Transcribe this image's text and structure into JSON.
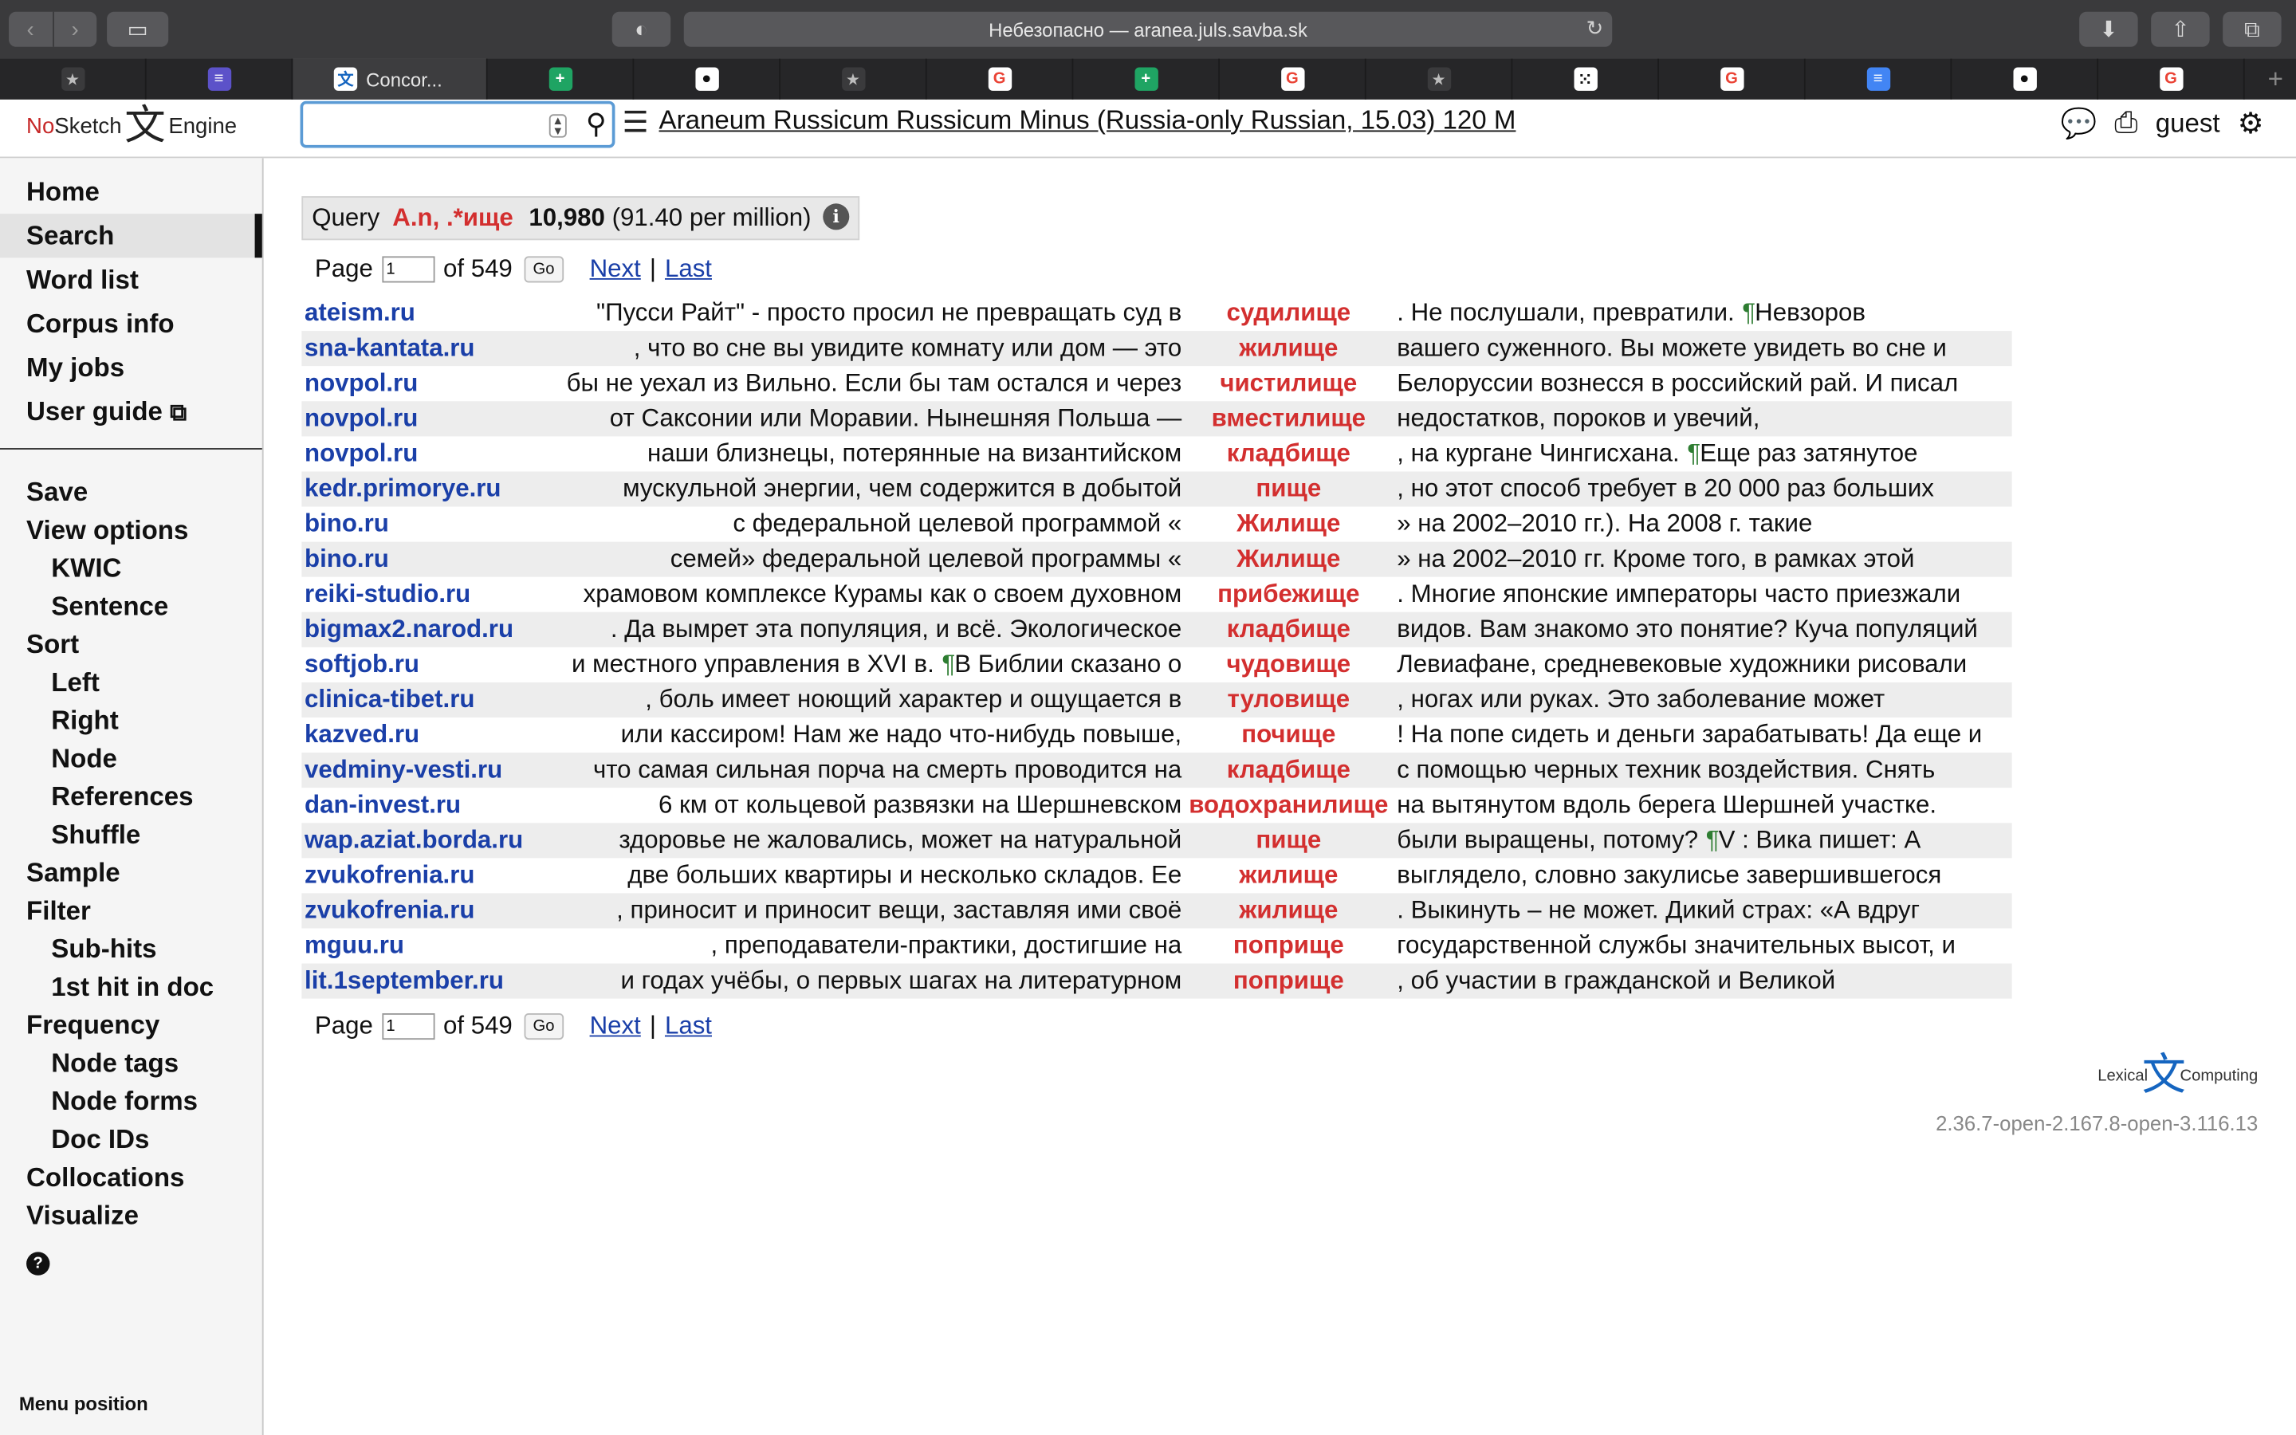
{
  "browser": {
    "url_text": "Небезопасно — aranea.juls.savba.sk",
    "active_tab_title": "Concor..."
  },
  "tabs": [
    {
      "icon": "star-icon",
      "glyph": "★",
      "bg": "#3a3a3c",
      "fg": "#bdbdbd"
    },
    {
      "icon": "list-icon",
      "glyph": "≡",
      "bg": "#5c52c9",
      "fg": "#ffffff"
    },
    {
      "icon": "sketch-engine-icon",
      "glyph": "文",
      "bg": "#ffffff",
      "fg": "#1565c0",
      "active": true
    },
    {
      "icon": "sheets-icon",
      "glyph": "+",
      "bg": "#1fa463",
      "fg": "#ffffff"
    },
    {
      "icon": "github-icon",
      "glyph": "●",
      "bg": "#ffffff",
      "fg": "#111111"
    },
    {
      "icon": "star-icon",
      "glyph": "★",
      "bg": "#3a3a3c",
      "fg": "#bdbdbd"
    },
    {
      "icon": "google-icon",
      "glyph": "G",
      "bg": "#ffffff",
      "fg": "#ea4335"
    },
    {
      "icon": "sheets-icon",
      "glyph": "+",
      "bg": "#1fa463",
      "fg": "#ffffff"
    },
    {
      "icon": "google-icon",
      "glyph": "G",
      "bg": "#ffffff",
      "fg": "#ea4335"
    },
    {
      "icon": "star-icon",
      "glyph": "★",
      "bg": "#3a3a3c",
      "fg": "#bdbdbd"
    },
    {
      "icon": "dice-icon",
      "glyph": "⁙",
      "bg": "#ffffff",
      "fg": "#111111"
    },
    {
      "icon": "google-icon",
      "glyph": "G",
      "bg": "#ffffff",
      "fg": "#ea4335"
    },
    {
      "icon": "docs-icon",
      "glyph": "≡",
      "bg": "#4285f4",
      "fg": "#ffffff"
    },
    {
      "icon": "github-icon",
      "glyph": "●",
      "bg": "#ffffff",
      "fg": "#111111"
    },
    {
      "icon": "google-icon",
      "glyph": "G",
      "bg": "#ffffff",
      "fg": "#ea4335"
    }
  ],
  "header": {
    "logo_no": "No",
    "logo_sketch": "Sketch",
    "logo_engine": "Engine",
    "search_value": "",
    "corpus_name": "Araneum Russicum Russicum Minus (Russia-only Russian, 15.03) 120 M",
    "user": "guest"
  },
  "sidebar": {
    "group1": [
      "Home",
      "Search",
      "Word list",
      "Corpus info",
      "My jobs",
      "User guide"
    ],
    "selected": "Search",
    "menu_position": "Menu position"
  },
  "query": {
    "label": "Query",
    "expr": "A.n, .*ище",
    "count": "10,980",
    "per_million": "(91.40 per million)"
  },
  "pager": {
    "page_label": "Page",
    "page_value": "1",
    "of_text": "of 549",
    "go": "Go",
    "next": "Next",
    "sep": "|",
    "last": "Last"
  },
  "concordance": [
    {
      "ref": "ateism.ru",
      "left": "\"Пусси Райт\" - просто просил не превращать суд в",
      "kw": "судилище",
      "right_pre": ". Не послушали, превратили. ",
      "para": "¶",
      "right_post": "Невзоров"
    },
    {
      "ref": "sna-kantata.ru",
      "left": ", что во сне вы увидите комнату или дом — это",
      "kw": "жилище",
      "right_pre": "вашего суженного. Вы можете увидеть во сне и",
      "para": "",
      "right_post": ""
    },
    {
      "ref": "novpol.ru",
      "left": "бы не уехал из Вильно. Если бы там остался и через",
      "kw": "чистилище",
      "right_pre": "Белоруссии вознесся в российский рай. И писал",
      "para": "",
      "right_post": ""
    },
    {
      "ref": "novpol.ru",
      "left": "от Саксонии или Моравии. Нынешняя Польша —",
      "kw": "вместилище",
      "right_pre": "недостатков, пороков и увечий,",
      "para": "",
      "right_post": ""
    },
    {
      "ref": "novpol.ru",
      "left": "наши близнецы, потерянные на византийском",
      "kw": "кладбище",
      "right_pre": ", на кургане Чингисхана. ",
      "para": "¶",
      "right_post": "Еще раз затянутое"
    },
    {
      "ref": "kedr.primorye.ru",
      "left": "мускульной энергии, чем содержится в добытой",
      "kw": "пище",
      "right_pre": ", но этот способ требует в 20 000 раз больших",
      "para": "",
      "right_post": ""
    },
    {
      "ref": "bino.ru",
      "left": "с федеральной целевой программой «",
      "kw": "Жилище",
      "right_pre": "» на 2002–2010 гг.). На 2008 г. такие",
      "para": "",
      "right_post": ""
    },
    {
      "ref": "bino.ru",
      "left": "семей» федеральной целевой программы «",
      "kw": "Жилище",
      "right_pre": "» на 2002–2010 гг. Кроме того, в рамках этой",
      "para": "",
      "right_post": ""
    },
    {
      "ref": "reiki-studio.ru",
      "left": "храмовом комплексе Курамы как о своем духовном",
      "kw": "прибежище",
      "right_pre": ". Многие японские императоры часто приезжали",
      "para": "",
      "right_post": ""
    },
    {
      "ref": "bigmax2.narod.ru",
      "left": ". Да вымрет эта популяция, и всё. Экологическое",
      "kw": "кладбище",
      "right_pre": "видов. Вам знакомо это понятие? Куча популяций",
      "para": "",
      "right_post": ""
    },
    {
      "ref": "softjob.ru",
      "left_pre": "и местного управления в XVI в. ",
      "left_para": "¶",
      "left": "В Библии сказано о",
      "kw": "чудовище",
      "right_pre": "Левиафане, средневековые художники рисовали",
      "para": "",
      "right_post": ""
    },
    {
      "ref": "clinica-tibet.ru",
      "left": ", боль имеет ноющий характер и ощущается в",
      "kw": "туловище",
      "right_pre": ", ногах или руках. Это заболевание может",
      "para": "",
      "right_post": ""
    },
    {
      "ref": "kazved.ru",
      "left": "или кассиром! Нам же надо что-нибудь повыше,",
      "kw": "почище",
      "right_pre": "! На попе сидеть и деньги зарабатывать! Да еще и",
      "para": "",
      "right_post": ""
    },
    {
      "ref": "vedminy-vesti.ru",
      "left": "что самая сильная порча на смерть проводится на",
      "kw": "кладбище",
      "right_pre": "с помощью черных техник воздействия. Снять",
      "para": "",
      "right_post": ""
    },
    {
      "ref": "dan-invest.ru",
      "left": "6 км от кольцевой развязки на Шершневском",
      "kw": "водохранилище",
      "right_pre": "на вытянутом вдоль берега Шершней участке.",
      "para": "",
      "right_post": ""
    },
    {
      "ref": "wap.aziat.borda.ru",
      "left": "здоровье не жаловались, может на натуральной",
      "kw": "пище",
      "right_pre": "были выращены, потому? ",
      "para": "¶",
      "right_post": "V : Вика пишет: А"
    },
    {
      "ref": "zvukofrenia.ru",
      "left": "две больших квартиры и несколько складов. Ее",
      "kw": "жилище",
      "right_pre": "выглядело, словно закулисье завершившегося",
      "para": "",
      "right_post": ""
    },
    {
      "ref": "zvukofrenia.ru",
      "left": ", приносит и приносит вещи, заставляя ими своё",
      "kw": "жилище",
      "right_pre": ". Выкинуть – не может. Дикий страх: «А вдруг",
      "para": "",
      "right_post": ""
    },
    {
      "ref": "mguu.ru",
      "left": ", преподаватели-практики, достигшие на",
      "kw": "поприще",
      "right_pre": "государственной службы значительных высот, и",
      "para": "",
      "right_post": ""
    },
    {
      "ref": "lit.1september.ru",
      "left": "и годах учёбы, о первых шагах на литературном",
      "kw": "поприще",
      "right_pre": ", об участии в гражданской и Великой",
      "para": "",
      "right_post": ""
    }
  ],
  "footer": {
    "lexical": "Lexical",
    "computing": "Computing",
    "version": "2.36.7-open-2.167.8-open-3.116.13"
  }
}
